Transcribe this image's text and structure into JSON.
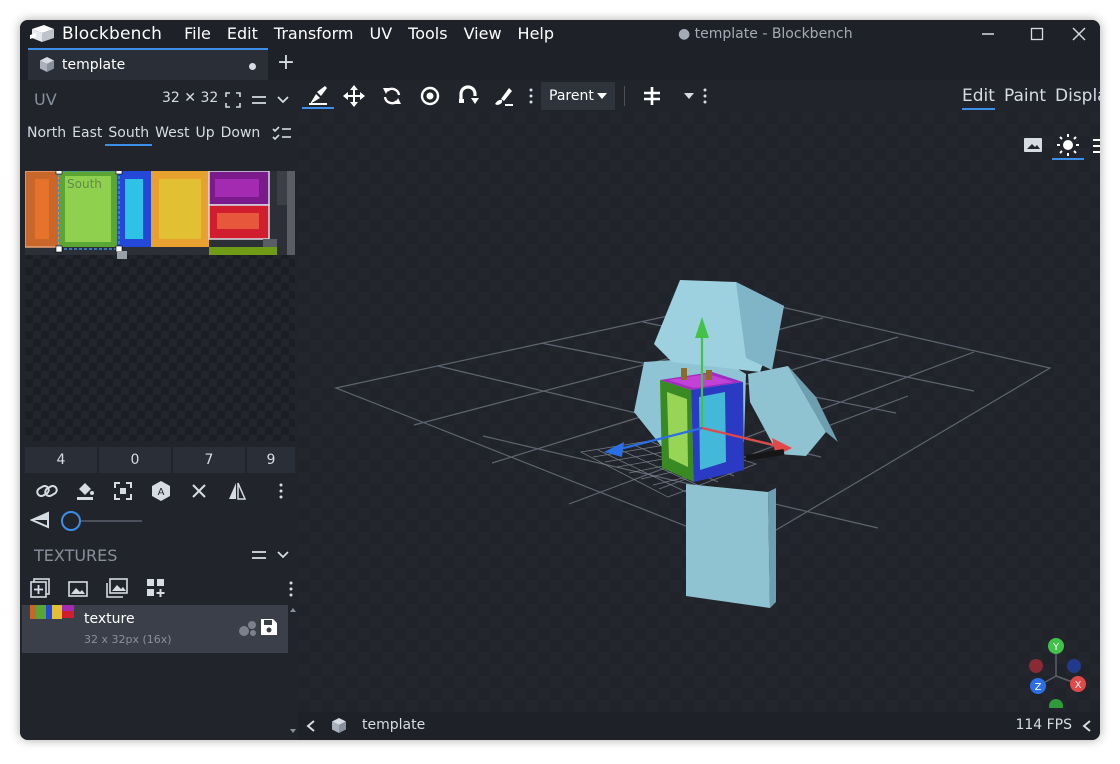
{
  "app": {
    "name": "Blockbench",
    "window_title": "● template - Blockbench"
  },
  "menu": [
    "File",
    "Edit",
    "Transform",
    "UV",
    "Tools",
    "View",
    "Help"
  ],
  "tabs": [
    {
      "label": "template",
      "unsaved": true
    }
  ],
  "uv_panel": {
    "title": "UV",
    "size": "32 ✕ 32",
    "face_tabs": [
      "North",
      "East",
      "South",
      "West",
      "Up",
      "Down"
    ],
    "active_face": "South",
    "face_label": "South",
    "coords": [
      "4",
      "0",
      "7",
      "9"
    ]
  },
  "textures_panel": {
    "title": "TEXTURES",
    "item_name": "texture",
    "item_meta": "32 x 32px (16x)"
  },
  "toolbar": {
    "pivot_dropdown": "Parent",
    "modes": [
      "Edit",
      "Paint",
      "Display"
    ],
    "active_mode": "Edit"
  },
  "status": {
    "model_name": "template",
    "fps": "114 FPS"
  },
  "gizmo": {
    "x": "X",
    "y": "Y",
    "z": "Z"
  },
  "colors": {
    "accent": "#3c8ee7",
    "axis_x": "#e53935",
    "axis_y": "#43a047",
    "axis_z": "#1e88e5"
  }
}
